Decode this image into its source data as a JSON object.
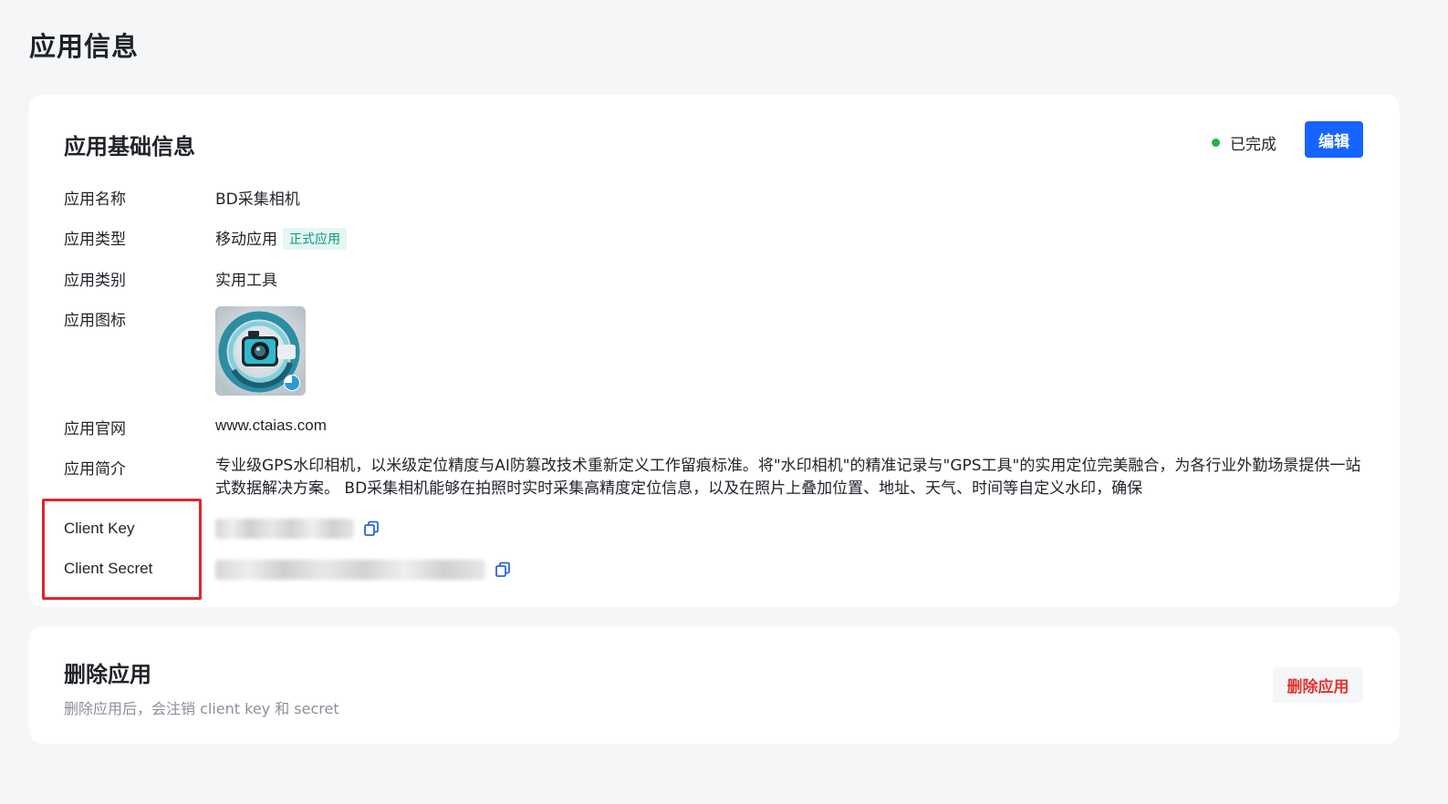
{
  "page": {
    "title": "应用信息"
  },
  "basic_info": {
    "title": "应用基础信息",
    "status": {
      "label": "已完成",
      "color": "#20b24a"
    },
    "edit_button": "编辑",
    "fields": {
      "name": {
        "label": "应用名称",
        "value": "BD采集相机"
      },
      "type": {
        "label": "应用类型",
        "value": "移动应用",
        "tag": "正式应用"
      },
      "category": {
        "label": "应用类别",
        "value": "实用工具"
      },
      "icon": {
        "label": "应用图标",
        "icon_name": "camera-app-icon"
      },
      "website": {
        "label": "应用官网",
        "value": "www.ctaias.com"
      },
      "intro": {
        "label": "应用简介",
        "value": "专业级GPS水印相机，以米级定位精度与AI防篡改技术重新定义工作留痕标准。将\"水印相机\"的精准记录与\"GPS工具\"的实用定位完美融合，为各行业外勤场景提供一站式数据解决方案。 BD采集相机能够在拍照时实时采集高精度定位信息，以及在照片上叠加位置、地址、天气、时间等自定义水印，确保"
      },
      "client_key": {
        "label": "Client Key",
        "icon_name": "copy-icon"
      },
      "client_secret": {
        "label": "Client Secret",
        "icon_name": "copy-icon"
      }
    },
    "accent_color": "#1664ff",
    "highlight_color": "#e0252a"
  },
  "delete_section": {
    "title": "删除应用",
    "description": "删除应用后，会注销 client key 和 secret",
    "button": "删除应用",
    "button_color": "#e5322d"
  }
}
